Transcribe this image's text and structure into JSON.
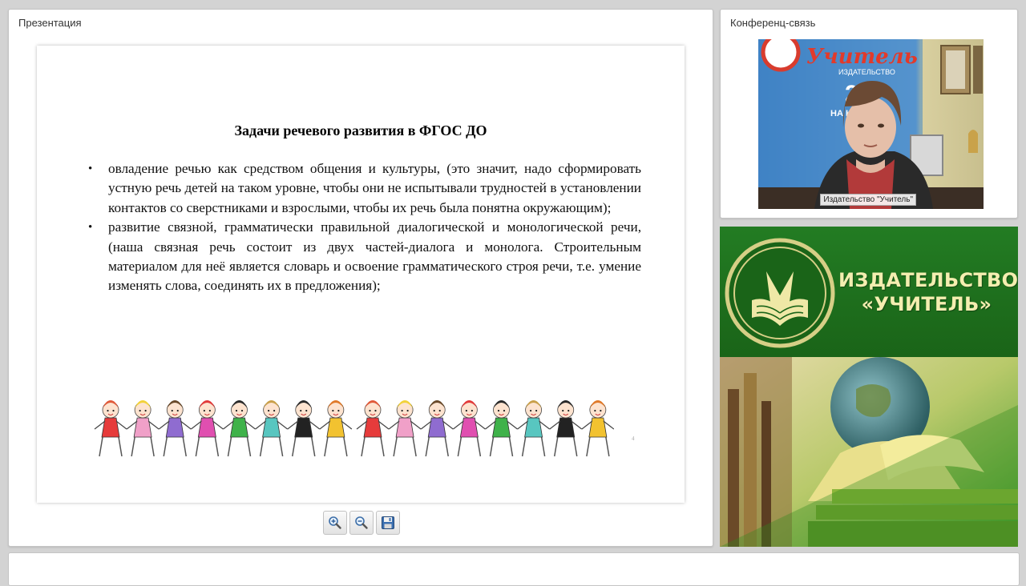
{
  "presentation": {
    "title": "Презентация",
    "slide": {
      "title": "Задачи речевого развития в ФГОС ДО",
      "bullets": [
        "овладение речью как средством общения и культуры, (это значит, надо сформировать устную речь детей на таком уровне, чтобы они не испытывали трудностей в установлении контактов со сверстниками и взрослыми, чтобы их речь была понятна окружающим);",
        "развитие связной, грамматически правильной диалогической и монологической речи, (наша связная речь состоит из двух частей-диалога и монолога. Строительным материалом для неё является словарь и освоение грамматического строя речи, т.е. умение изменять слова, соединять их в предложения);"
      ],
      "page_number": "4"
    },
    "toolbar": {
      "zoom_in_icon": "zoom-in-icon",
      "zoom_out_icon": "zoom-out-icon",
      "save_icon": "floppy-disk-icon"
    }
  },
  "conference": {
    "title": "Конференц-связь",
    "participant_label": "Издательство \"Учитель\"",
    "backdrop_sign": "Учитель",
    "backdrop_sub": "ИЗДАТЕЛЬСТВО",
    "backdrop_years": "25",
    "backdrop_tagline": "НА КНИЖ"
  },
  "banner": {
    "line1": "ИЗДАТЕЛЬСТВО",
    "line2": "«УЧИТЕЛЬ»"
  },
  "colors": {
    "banner_green": "#1d6a1d",
    "banner_text": "#f4eeb0",
    "panel_bg": "#ffffff",
    "page_bg": "#d3d3d3"
  }
}
